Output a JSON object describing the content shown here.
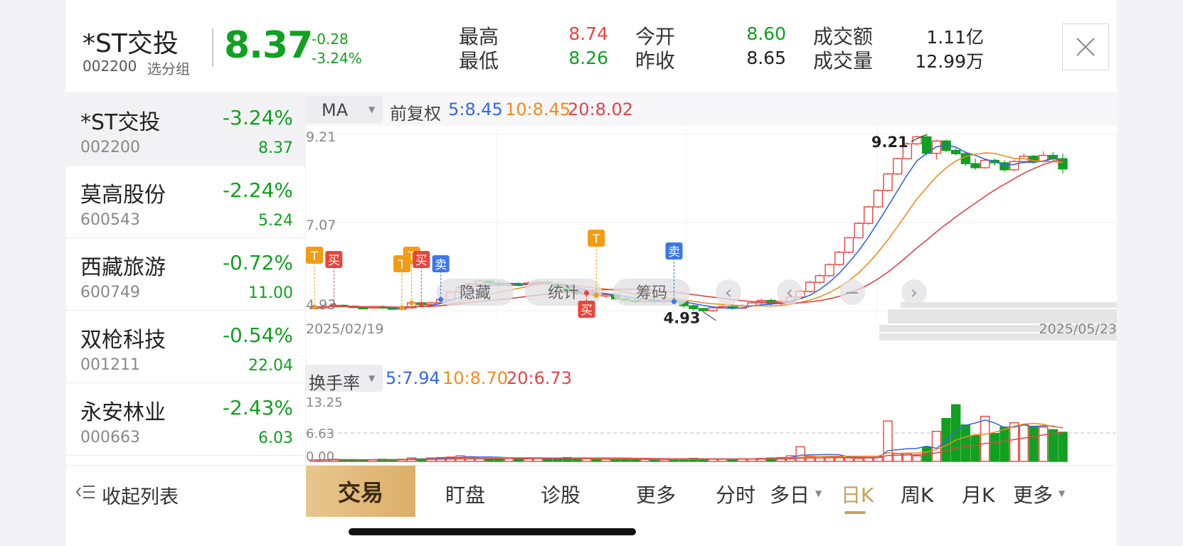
{
  "header": {
    "name": "*ST交投",
    "code": "002200",
    "group": "选分组",
    "price": "8.37",
    "change": "-0.28",
    "change_pct": "-3.24%",
    "stats": [
      {
        "label": "最高",
        "value": "8.74",
        "color": "#e8453c"
      },
      {
        "label": "最低",
        "value": "8.26",
        "color": "#11a020"
      },
      {
        "label": "今开",
        "value": "8.60",
        "color": "#11a020"
      },
      {
        "label": "昨收",
        "value": "8.65",
        "color": "#222222"
      },
      {
        "label": "成交额",
        "value": "1.11亿",
        "color": "#222222"
      },
      {
        "label": "成交量",
        "value": "12.99万",
        "color": "#222222"
      }
    ]
  },
  "sidebar": {
    "items": [
      {
        "name": "*ST交投",
        "code": "002200",
        "pct": "-3.24%",
        "price": "8.37"
      },
      {
        "name": "莫高股份",
        "code": "600543",
        "pct": "-2.24%",
        "price": "5.24"
      },
      {
        "name": "西藏旅游",
        "code": "600749",
        "pct": "-0.72%",
        "price": "11.00"
      },
      {
        "name": "双枪科技",
        "code": "001211",
        "pct": "-0.54%",
        "price": "22.04"
      },
      {
        "name": "永安林业",
        "code": "000663",
        "pct": "-2.43%",
        "price": "6.03"
      }
    ],
    "collapse_label": "收起列表"
  },
  "chart_controls": {
    "ma_select": "MA",
    "adjust": "前复权",
    "ma5": "5:8.45",
    "ma10": "10:8.45",
    "ma20": "20:8.02",
    "overlay_buttons": [
      "隐藏",
      "统计",
      "筹码"
    ],
    "vol_select": "换手率",
    "vol5": "5:7.94",
    "vol10": "10:8.70",
    "vol20": "20:6.73"
  },
  "colors": {
    "up": "#e8453c",
    "down": "#11a020",
    "ma5": "#3366e6",
    "ma10": "#f08c1e",
    "ma20": "#e0444a",
    "accent": "#c8a25d"
  },
  "chart_data": [
    {
      "type": "candlestick",
      "y_axis_labels": [
        "9.21",
        "7.07",
        "4.93"
      ],
      "ylim": [
        4.93,
        9.21
      ],
      "x_labels": [
        "2025/02/19",
        "2025/05/23"
      ],
      "annotations": {
        "high": "9.21",
        "low": "4.93"
      },
      "candles": [
        [
          5.0,
          5.02,
          4.98,
          5.04
        ],
        [
          5.02,
          5.03,
          4.99,
          5.06
        ],
        [
          5.03,
          5.06,
          5.0,
          5.08
        ],
        [
          5.06,
          5.04,
          5.02,
          5.08
        ],
        [
          5.04,
          5.01,
          4.99,
          5.06
        ],
        [
          5.01,
          5.0,
          4.97,
          5.03
        ],
        [
          5.0,
          5.03,
          4.98,
          5.05
        ],
        [
          5.03,
          5.0,
          4.98,
          5.06
        ],
        [
          5.0,
          4.97,
          4.95,
          5.03
        ],
        [
          4.97,
          5.0,
          4.94,
          5.02
        ],
        [
          5.0,
          5.12,
          4.98,
          5.15
        ],
        [
          5.12,
          5.08,
          5.05,
          5.16
        ],
        [
          5.08,
          5.12,
          5.05,
          5.15
        ],
        [
          5.12,
          5.2,
          5.1,
          5.23
        ],
        [
          5.2,
          5.38,
          5.18,
          5.42
        ],
        [
          5.38,
          5.5,
          5.33,
          5.53
        ],
        [
          5.5,
          5.58,
          5.45,
          5.62
        ],
        [
          5.58,
          5.65,
          5.52,
          5.7
        ],
        [
          5.65,
          5.6,
          5.55,
          5.7
        ],
        [
          5.6,
          5.55,
          5.5,
          5.65
        ],
        [
          5.55,
          5.58,
          5.5,
          5.62
        ],
        [
          5.58,
          5.56,
          5.52,
          5.62
        ],
        [
          5.56,
          5.6,
          5.53,
          5.64
        ],
        [
          5.6,
          5.62,
          5.55,
          5.66
        ],
        [
          5.62,
          5.58,
          5.54,
          5.68
        ],
        [
          5.58,
          5.5,
          5.46,
          5.62
        ],
        [
          5.5,
          5.38,
          5.3,
          5.55
        ],
        [
          5.38,
          5.35,
          5.3,
          5.42
        ],
        [
          5.35,
          5.36,
          5.3,
          5.4
        ],
        [
          5.36,
          5.3,
          5.25,
          5.4
        ],
        [
          5.3,
          5.32,
          5.25,
          5.36
        ],
        [
          5.32,
          5.22,
          5.18,
          5.35
        ],
        [
          5.22,
          5.18,
          5.12,
          5.26
        ],
        [
          5.18,
          5.15,
          5.1,
          5.22
        ],
        [
          5.15,
          5.2,
          5.1,
          5.24
        ],
        [
          5.2,
          5.15,
          5.1,
          5.24
        ],
        [
          5.15,
          5.18,
          5.1,
          5.22
        ],
        [
          5.18,
          5.15,
          5.12,
          5.22
        ],
        [
          5.15,
          5.05,
          5.0,
          5.18
        ],
        [
          5.05,
          4.98,
          4.93,
          5.08
        ],
        [
          4.98,
          4.93,
          4.9,
          5.0
        ],
        [
          4.93,
          5.0,
          4.9,
          5.03
        ],
        [
          5.0,
          5.03,
          4.98,
          5.06
        ],
        [
          5.03,
          4.99,
          4.96,
          5.06
        ],
        [
          4.99,
          5.05,
          4.97,
          5.08
        ],
        [
          5.05,
          5.12,
          5.02,
          5.15
        ],
        [
          5.12,
          5.18,
          5.08,
          5.22
        ],
        [
          5.18,
          5.1,
          5.06,
          5.22
        ],
        [
          5.1,
          5.16,
          5.06,
          5.2
        ],
        [
          5.16,
          5.26,
          5.12,
          5.3
        ],
        [
          5.26,
          5.4,
          5.22,
          5.45
        ],
        [
          5.4,
          5.62,
          5.36,
          5.66
        ],
        [
          5.62,
          5.78,
          5.58,
          5.82
        ],
        [
          5.78,
          6.05,
          5.75,
          6.08
        ],
        [
          6.05,
          6.35,
          6.02,
          6.38
        ],
        [
          6.35,
          6.7,
          6.32,
          6.72
        ],
        [
          6.7,
          7.05,
          6.68,
          7.08
        ],
        [
          7.05,
          7.45,
          7.02,
          7.48
        ],
        [
          7.45,
          7.85,
          7.42,
          7.88
        ],
        [
          7.85,
          8.25,
          7.82,
          8.28
        ],
        [
          8.25,
          8.62,
          8.22,
          8.65
        ],
        [
          8.62,
          8.98,
          8.6,
          9.02
        ],
        [
          8.98,
          9.15,
          8.95,
          9.18
        ],
        [
          9.15,
          8.75,
          8.7,
          9.21
        ],
        [
          8.75,
          9.05,
          8.6,
          9.08
        ],
        [
          9.05,
          8.82,
          8.78,
          9.08
        ],
        [
          8.82,
          8.74,
          8.7,
          8.88
        ],
        [
          8.74,
          8.5,
          8.45,
          8.8
        ],
        [
          8.5,
          8.4,
          8.35,
          8.62
        ],
        [
          8.4,
          8.58,
          8.38,
          8.62
        ],
        [
          8.58,
          8.52,
          8.45,
          8.62
        ],
        [
          8.52,
          8.35,
          8.3,
          8.58
        ],
        [
          8.35,
          8.55,
          8.32,
          8.6
        ],
        [
          8.55,
          8.68,
          8.5,
          8.75
        ],
        [
          8.68,
          8.55,
          8.5,
          8.72
        ],
        [
          8.55,
          8.7,
          8.52,
          8.8
        ],
        [
          8.7,
          8.62,
          8.55,
          8.78
        ],
        [
          8.62,
          8.37,
          8.26,
          8.74
        ]
      ],
      "markers": [
        {
          "label": "T",
          "index": 0,
          "color": "#f39c12"
        },
        {
          "label": "买",
          "index": 2,
          "color": "#e8453c"
        },
        {
          "label": "T",
          "index": 9,
          "color": "#f39c12"
        },
        {
          "label": "T",
          "index": 10,
          "color": "#f39c12"
        },
        {
          "label": "买",
          "index": 11,
          "color": "#e8453c"
        },
        {
          "label": "卖",
          "index": 13,
          "color": "#3a78e8"
        },
        {
          "label": "T",
          "index": 29,
          "color": "#f39c12"
        },
        {
          "label": "买",
          "index": 28,
          "color": "#e8453c"
        },
        {
          "label": "卖",
          "index": 37,
          "color": "#3a78e8"
        }
      ]
    },
    {
      "type": "bar",
      "title": "换手率",
      "y_axis_labels": [
        "13.25",
        "6.63",
        "0.00"
      ],
      "ylim": [
        0,
        13.25
      ],
      "values": [
        0.3,
        0.4,
        0.5,
        0.4,
        0.4,
        0.3,
        0.4,
        0.5,
        0.4,
        0.5,
        0.8,
        0.6,
        0.8,
        0.9,
        1.0,
        1.3,
        1.1,
        0.9,
        0.9,
        0.8,
        0.7,
        0.6,
        0.6,
        0.7,
        0.6,
        0.8,
        0.9,
        0.7,
        0.6,
        0.6,
        0.5,
        0.5,
        0.5,
        0.4,
        0.5,
        0.4,
        0.4,
        0.5,
        0.6,
        0.7,
        0.6,
        0.5,
        0.5,
        0.5,
        0.6,
        0.6,
        0.7,
        0.8,
        0.9,
        1.3,
        3.4,
        1.2,
        1.1,
        1.1,
        1.0,
        0.8,
        0.7,
        0.8,
        0.9,
        9.4,
        1.8,
        1.8,
        1.3,
        3.3,
        7.0,
        10.0,
        13.2,
        8.5,
        6.0,
        10.5,
        6.5,
        8.0,
        9.0,
        8.5,
        8.2,
        8.0,
        7.4,
        6.8
      ]
    }
  ],
  "toolbar": {
    "trade": "交易",
    "items": [
      "盯盘",
      "诊股",
      "更多"
    ],
    "periods": [
      "分时",
      "多日",
      "日K",
      "周K",
      "月K",
      "更多"
    ],
    "active_period": "日K"
  }
}
